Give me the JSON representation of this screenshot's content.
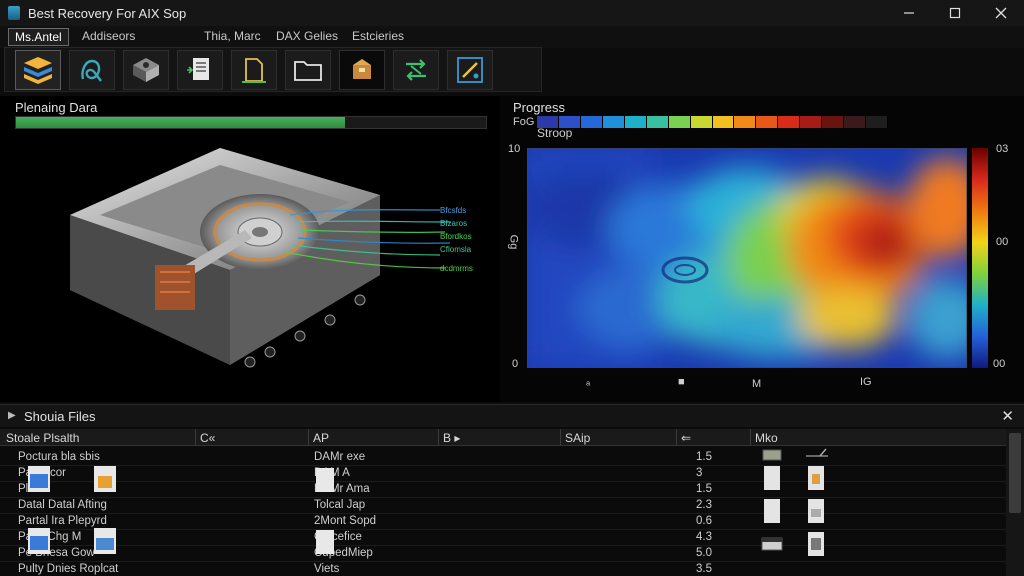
{
  "window": {
    "title": "Best Recovery For AIX Sop"
  },
  "menu": {
    "items": [
      "Ms.Antel",
      "Addiseors",
      "Thia, Marc",
      "DAX Gelies",
      "Estcieries"
    ]
  },
  "toolbar": {
    "buttons": [
      "layers-icon",
      "lasso-icon",
      "chip-icon",
      "document-scan-icon",
      "folder-line-icon",
      "folder-icon",
      "package-icon",
      "swap-icon",
      "edit-icon"
    ]
  },
  "left_panel": {
    "title": "Plenaing Dara",
    "progress": 0.7
  },
  "hdd_labels": [
    "Bfcsfds",
    "Bfzaros",
    "Bfordkos",
    "Cflomsla",
    "dcdmrms"
  ],
  "right_panel": {
    "title": "Progress",
    "legend_top": "FoG O",
    "subtitle": "Stroop",
    "y_top": "10",
    "y_mid": "Gg",
    "y_bottom": "0",
    "x_ticks": [
      "ₐ",
      "■",
      "M",
      "IG"
    ],
    "cb_top": "03",
    "cb_mid": "00",
    "cb_bottom": "00",
    "strip_colors": [
      "#2c3aa8",
      "#2b50c8",
      "#2768d8",
      "#2090d8",
      "#1eb0c8",
      "#38c0a0",
      "#7ad050",
      "#c8d830",
      "#f0c020",
      "#f08a18",
      "#e85818",
      "#d82c18",
      "#a81c18",
      "#6a1410",
      "#3a1a1a",
      "#1e1e1e"
    ]
  },
  "files": {
    "title": "Shouia Files",
    "columns": [
      "Stoale Plsalth",
      "C«",
      "AP",
      "B ▸",
      "SAip",
      "⇐",
      "Mko"
    ],
    "rows": [
      {
        "name": "Poctura bla sbis",
        "path": "DAMr exe",
        "size": "1.5"
      },
      {
        "name": "Pa      Cecor",
        "path": "DAM A",
        "size": "3"
      },
      {
        "name": "Plsta l",
        "path": "DAMr Ama",
        "size": "1.5"
      },
      {
        "name": "Datal Datal Afting",
        "path": "Tolcal Jap",
        "size": "2.3"
      },
      {
        "name": "Partal Ira Plepyrd",
        "path": "2Mont Sopd",
        "size": "0.6"
      },
      {
        "name": "Pafin  Chg M",
        "path": "Catcefice",
        "size": "4.3"
      },
      {
        "name": "Pe  Bnesa  Gow",
        "path": "CdpedMiep",
        "size": "5.0"
      },
      {
        "name": "Pulty Dnies Roplcat",
        "path": "Viets",
        "size": "3.5"
      }
    ]
  }
}
